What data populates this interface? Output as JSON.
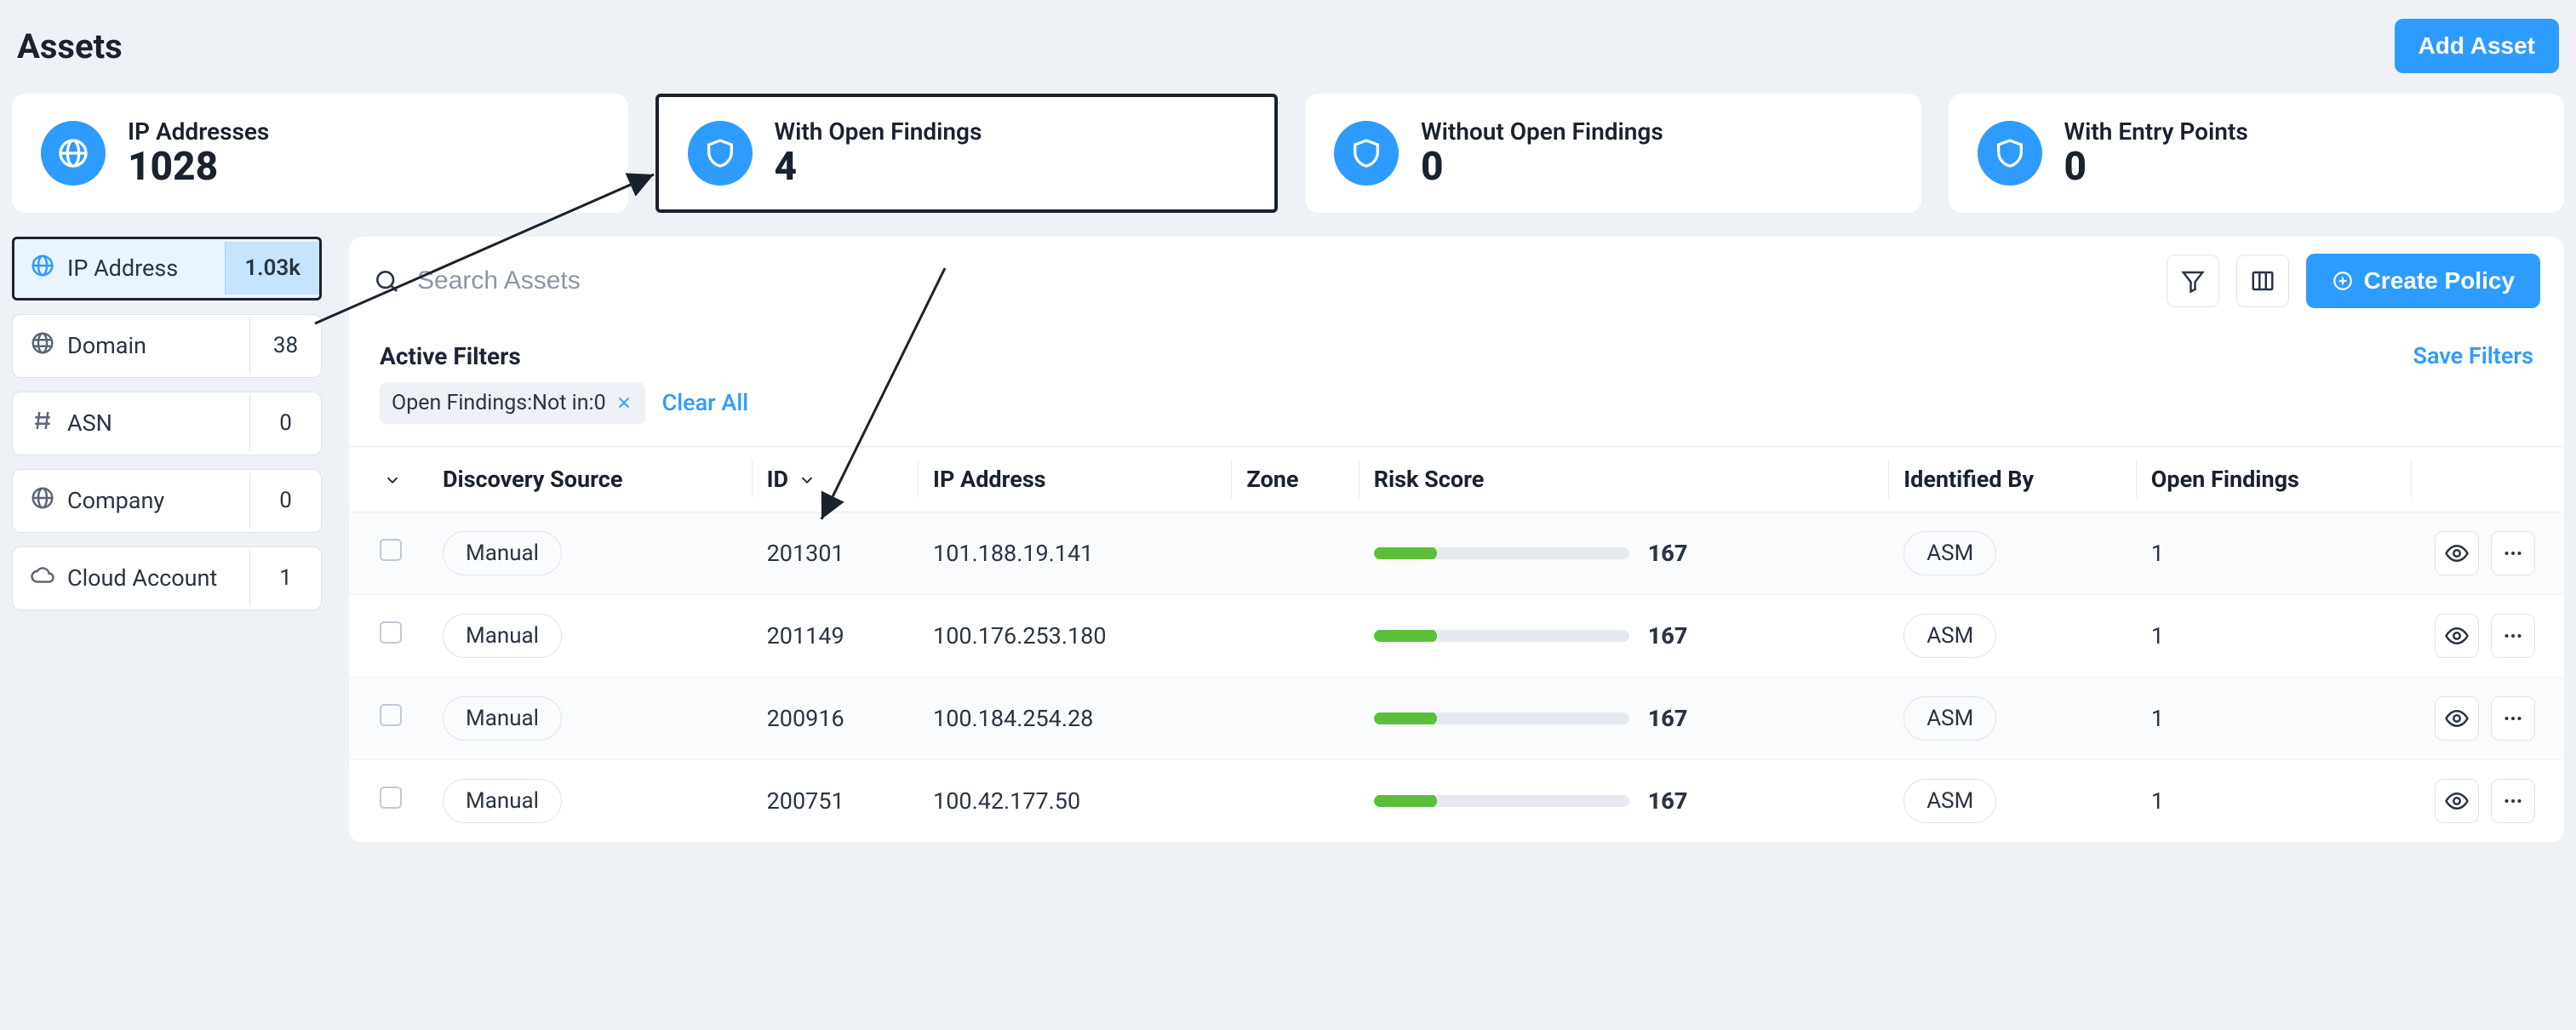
{
  "header": {
    "title": "Assets",
    "add_button": "Add Asset"
  },
  "stats": [
    {
      "label": "IP Addresses",
      "value": "1028",
      "icon": "globe",
      "highlight": false
    },
    {
      "label": "With Open Findings",
      "value": "4",
      "icon": "shield",
      "highlight": true
    },
    {
      "label": "Without Open Findings",
      "value": "0",
      "icon": "shield",
      "highlight": false
    },
    {
      "label": "With Entry Points",
      "value": "0",
      "icon": "shield",
      "highlight": false
    }
  ],
  "sidebar": {
    "items": [
      {
        "label": "IP Address",
        "count": "1.03k",
        "icon": "globe",
        "active": true
      },
      {
        "label": "Domain",
        "count": "38",
        "icon": "globe-grid",
        "active": false
      },
      {
        "label": "ASN",
        "count": "0",
        "icon": "hash",
        "active": false
      },
      {
        "label": "Company",
        "count": "0",
        "icon": "globe",
        "active": false
      },
      {
        "label": "Cloud Account",
        "count": "1",
        "icon": "cloud",
        "active": false
      }
    ]
  },
  "search": {
    "placeholder": "Search Assets"
  },
  "toolbar": {
    "create_policy": "Create Policy"
  },
  "filters": {
    "heading": "Active Filters",
    "chips": [
      {
        "text": "Open Findings:Not in:0"
      }
    ],
    "clear_all": "Clear All",
    "save": "Save Filters"
  },
  "table": {
    "columns": {
      "discovery": "Discovery Source",
      "id": "ID",
      "ip": "IP Address",
      "zone": "Zone",
      "risk": "Risk Score",
      "identified": "Identified By",
      "findings": "Open Findings"
    },
    "rows": [
      {
        "discovery": "Manual",
        "id": "201301",
        "ip": "101.188.19.141",
        "zone": "",
        "risk_pct": 22,
        "risk_score": "167",
        "identified": "ASM",
        "findings": "1"
      },
      {
        "discovery": "Manual",
        "id": "201149",
        "ip": "100.176.253.180",
        "zone": "",
        "risk_pct": 22,
        "risk_score": "167",
        "identified": "ASM",
        "findings": "1"
      },
      {
        "discovery": "Manual",
        "id": "200916",
        "ip": "100.184.254.28",
        "zone": "",
        "risk_pct": 22,
        "risk_score": "167",
        "identified": "ASM",
        "findings": "1"
      },
      {
        "discovery": "Manual",
        "id": "200751",
        "ip": "100.42.177.50",
        "zone": "",
        "risk_pct": 22,
        "risk_score": "167",
        "identified": "ASM",
        "findings": "1"
      }
    ]
  }
}
